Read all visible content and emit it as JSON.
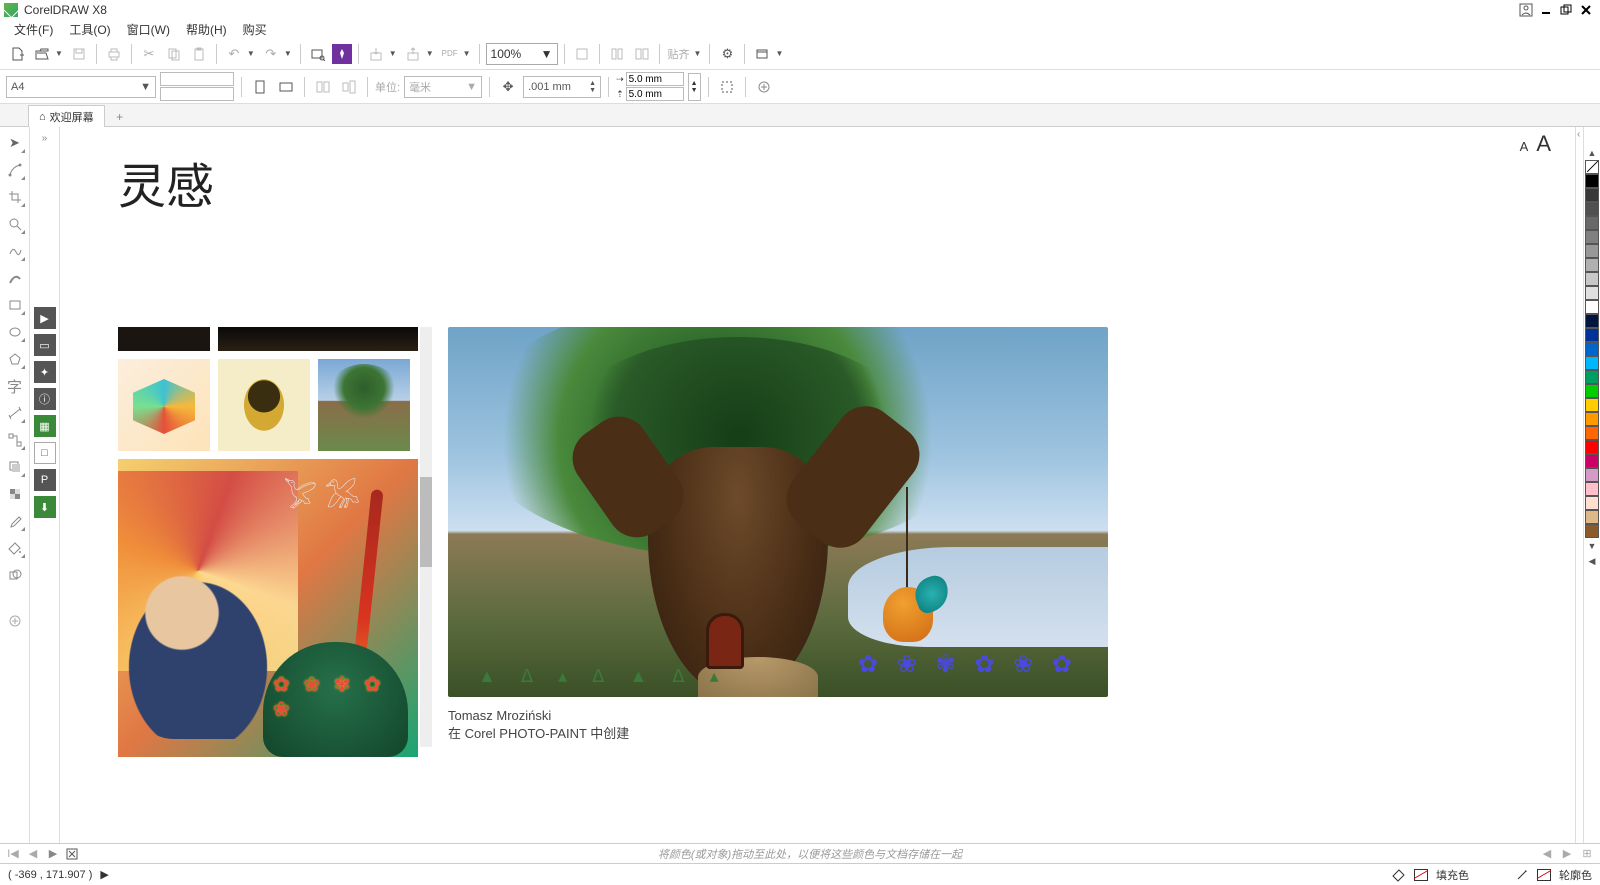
{
  "app": {
    "title": "CorelDRAW X8"
  },
  "menu": {
    "file": "文件(F)",
    "tools": "工具(O)",
    "window": "窗口(W)",
    "help": "帮助(H)",
    "buy": "购买"
  },
  "toolbar": {
    "zoom": "100%",
    "align_label": "贴齐"
  },
  "properties": {
    "page_size": "A4",
    "unit_label": "单位:",
    "unit_value": "毫米",
    "nudge": ".001 mm",
    "dupx": "5.0 mm",
    "dupy": "5.0 mm"
  },
  "tab": {
    "welcome": "欢迎屏幕"
  },
  "welcome": {
    "heading": "灵感",
    "artist": "Tomasz Mroziński",
    "created_in": "在 Corel PHOTO-PAINT 中创建",
    "font_small": "A",
    "font_large": "A"
  },
  "palette_colors": [
    "#000000",
    "#383838",
    "#505050",
    "#686868",
    "#808080",
    "#989898",
    "#b0b0b0",
    "#c8c8c8",
    "#e0e0e0",
    "#ffffff",
    "#00163f",
    "#003399",
    "#0066cc",
    "#00b7ff",
    "#009e60",
    "#00cc00",
    "#ffcc00",
    "#ff9900",
    "#ff6600",
    "#ff0000",
    "#cc0066",
    "#d49bc6",
    "#ffc0cb",
    "#ffe0d0",
    "#deb887",
    "#8b5a2b"
  ],
  "pagebar": {
    "hint": "将颜色(或对象)拖动至此处，以便将这些颜色与文档存储在一起"
  },
  "status": {
    "cursor": "( -369 , 171.907 )",
    "fill_label": "填充色",
    "outline_label": "轮廓色"
  }
}
